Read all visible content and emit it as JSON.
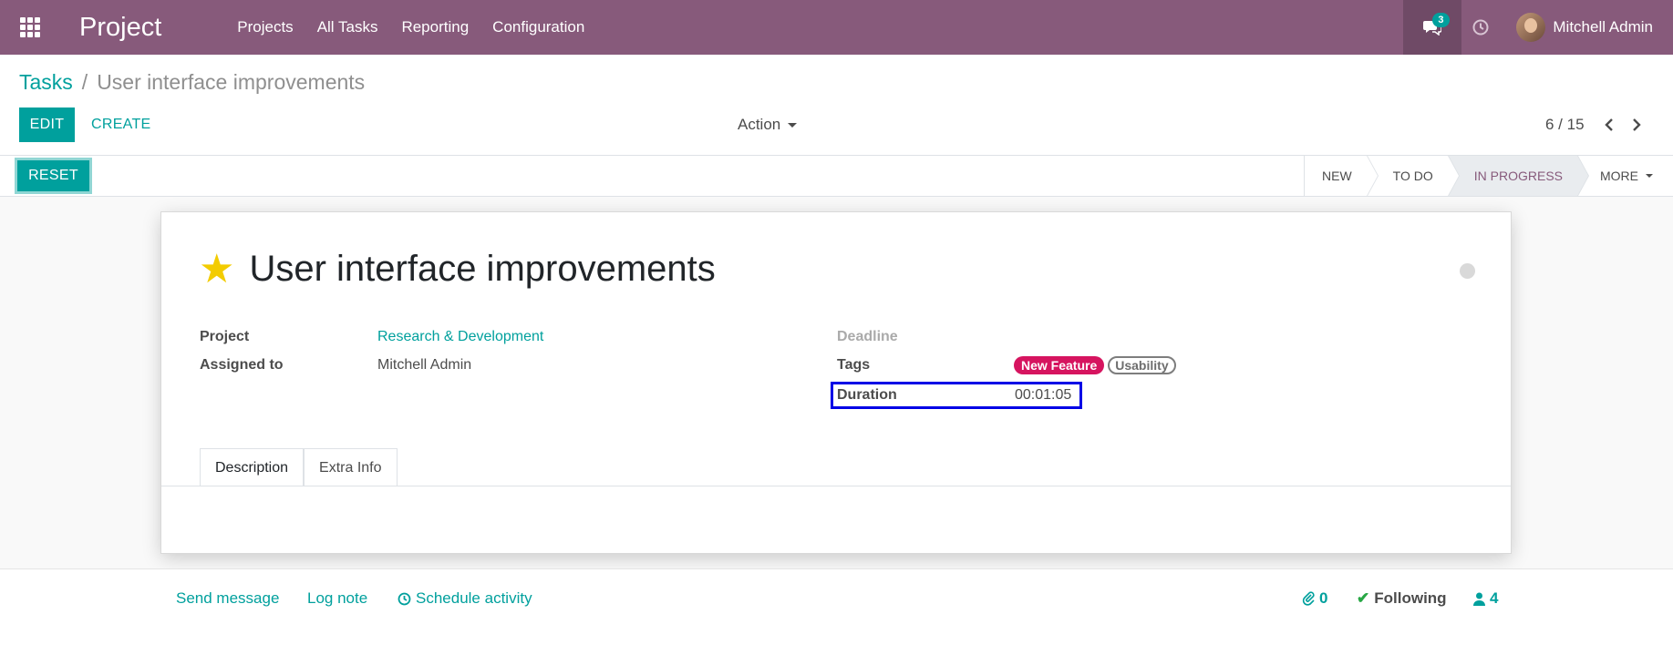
{
  "navbar": {
    "brand": "Project",
    "menu": [
      "Projects",
      "All Tasks",
      "Reporting",
      "Configuration"
    ],
    "chat_count": "3",
    "user_name": "Mitchell Admin"
  },
  "breadcrumb": {
    "parent": "Tasks",
    "separator": "/",
    "current": "User interface improvements"
  },
  "control": {
    "edit_label": "EDIT",
    "create_label": "CREATE",
    "action_label": "Action",
    "pager": "6 / 15"
  },
  "statusbar": {
    "reset_label": "RESET",
    "stages": [
      "NEW",
      "TO DO",
      "IN PROGRESS"
    ],
    "active_stage": "IN PROGRESS",
    "more_label": "MORE"
  },
  "task": {
    "title": "User interface improvements",
    "starred": true,
    "fields": {
      "project_label": "Project",
      "project_value": "Research & Development",
      "assigned_label": "Assigned to",
      "assigned_value": "Mitchell Admin",
      "deadline_label": "Deadline",
      "tags_label": "Tags",
      "tags": [
        "New Feature",
        "Usability"
      ],
      "duration_label": "Duration",
      "duration_value": "00:01:05"
    },
    "tabs": [
      "Description",
      "Extra Info"
    ]
  },
  "chatter": {
    "send_message": "Send message",
    "log_note": "Log note",
    "schedule_activity": "Schedule activity",
    "attachments_count": "0",
    "following_label": "Following",
    "followers_count": "4"
  },
  "colors": {
    "navbar": "#875a7b",
    "primary": "#00a09d",
    "tag_new_feature": "#d6145f",
    "highlight_box": "#0000e6"
  }
}
